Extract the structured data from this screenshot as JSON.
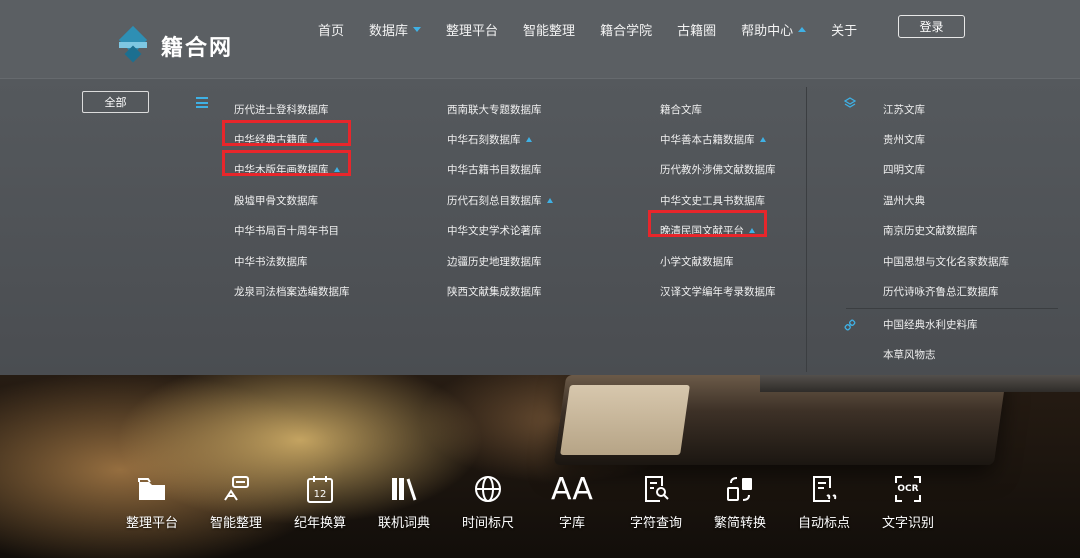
{
  "header": {
    "logo_text": "籍合网",
    "nav": [
      {
        "label": "首页"
      },
      {
        "label": "数据库",
        "caret": "down"
      },
      {
        "label": "整理平台"
      },
      {
        "label": "智能整理"
      },
      {
        "label": "籍合学院"
      },
      {
        "label": "古籍圈"
      },
      {
        "label": "帮助中心",
        "caret": "up"
      },
      {
        "label": "关于"
      }
    ],
    "login_label": "登录"
  },
  "panel": {
    "all_label": "全部",
    "col1": [
      {
        "label": "历代进士登科数据库"
      },
      {
        "label": "中华经典古籍库",
        "caret": true
      },
      {
        "label": "中华木版年画数据库",
        "caret": true
      },
      {
        "label": "殷墟甲骨文数据库"
      },
      {
        "label": "中华书局百十周年书目"
      },
      {
        "label": "中华书法数据库"
      },
      {
        "label": "龙泉司法档案选编数据库"
      }
    ],
    "col2": [
      {
        "label": "西南联大专题数据库"
      },
      {
        "label": "中华石刻数据库",
        "caret": true
      },
      {
        "label": "中华古籍书目数据库"
      },
      {
        "label": "历代石刻总目数据库",
        "caret": true
      },
      {
        "label": "中华文史学术论著库"
      },
      {
        "label": "边疆历史地理数据库"
      },
      {
        "label": "陕西文献集成数据库"
      }
    ],
    "col3": [
      {
        "label": "籍合文库"
      },
      {
        "label": "中华善本古籍数据库",
        "caret": true
      },
      {
        "label": "历代教外涉佛文献数据库"
      },
      {
        "label": "中华文史工具书数据库"
      },
      {
        "label": "晚清民国文献平台",
        "caret": true
      },
      {
        "label": "小学文献数据库"
      },
      {
        "label": "汉译文学编年考录数据库"
      }
    ],
    "col4": [
      {
        "label": "江苏文库"
      },
      {
        "label": "贵州文库"
      },
      {
        "label": "四明文库"
      },
      {
        "label": "温州大典"
      },
      {
        "label": "南京历史文献数据库"
      },
      {
        "label": "中国思想与文化名家数据库"
      },
      {
        "label": "历代诗咏齐鲁总汇数据库"
      }
    ],
    "col5": [
      {
        "label": "中国经典水利史料库"
      },
      {
        "label": "本草风物志"
      }
    ]
  },
  "tools": [
    {
      "label": "整理平台",
      "icon": "folder-icon"
    },
    {
      "label": "智能整理",
      "icon": "smart-edit-icon"
    },
    {
      "label": "纪年换算",
      "icon": "calendar-icon"
    },
    {
      "label": "联机词典",
      "icon": "books-icon"
    },
    {
      "label": "时间标尺",
      "icon": "globe-icon"
    },
    {
      "label": "字库",
      "icon": "font-icon",
      "glyph": "AA"
    },
    {
      "label": "字符查询",
      "icon": "doc-search-icon"
    },
    {
      "label": "繁简转换",
      "icon": "convert-icon"
    },
    {
      "label": "自动标点",
      "icon": "punctuation-icon"
    },
    {
      "label": "文字识别",
      "icon": "ocr-icon",
      "glyph": "OCR"
    }
  ],
  "colors": {
    "header_bg": "#5b5f63",
    "accent": "#3fb1e5",
    "highlight": "#e8262b"
  }
}
